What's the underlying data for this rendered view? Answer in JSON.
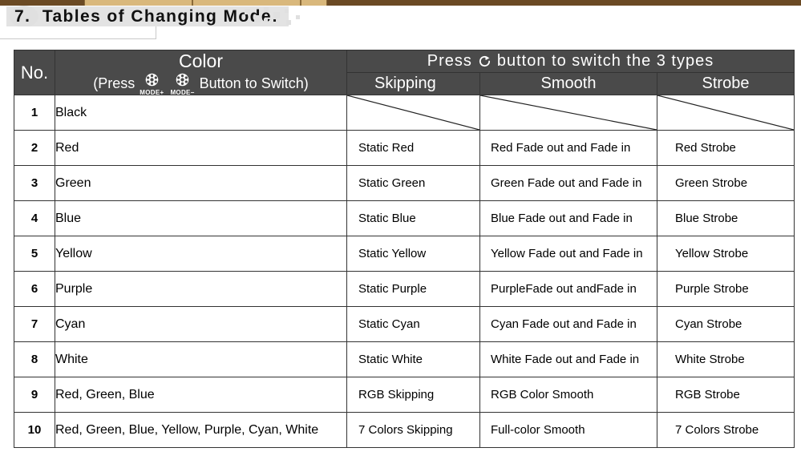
{
  "top_bar": {
    "segments": 3
  },
  "heading": {
    "number": "7.",
    "text": "Tables of Changing Mode:"
  },
  "table": {
    "header": {
      "no_label": "No.",
      "color_title": "Color",
      "color_sub_prefix": "(Press",
      "color_sub_suffix": "Button to Switch)",
      "mode_plus_icon": "film-reel-icon",
      "mode_plus_caption": "MODE+",
      "mode_minus_icon": "film-reel-icon",
      "mode_minus_caption": "MODE−",
      "press_prefix": "Press",
      "press_icon": "circular-arrow-icon",
      "press_suffix": "button  to  switch  the  3  types",
      "type_columns": [
        "Skipping",
        "Smooth",
        "Strobe"
      ]
    },
    "rows": [
      {
        "no": "1",
        "color": "Black",
        "skipping": "",
        "smooth": "",
        "strobe": "",
        "struck": true
      },
      {
        "no": "2",
        "color": "Red",
        "skipping": "Static Red",
        "smooth": "Red Fade out and Fade in",
        "strobe": "Red Strobe",
        "struck": false
      },
      {
        "no": "3",
        "color": "Green",
        "skipping": "Static Green",
        "smooth": "Green Fade out and Fade in",
        "strobe": "Green Strobe",
        "struck": false
      },
      {
        "no": "4",
        "color": "Blue",
        "skipping": "Static Blue",
        "smooth": "Blue Fade out and Fade in",
        "strobe": "Blue Strobe",
        "struck": false
      },
      {
        "no": "5",
        "color": "Yellow",
        "skipping": "Static Yellow",
        "smooth": "Yellow Fade out and Fade in",
        "strobe": "Yellow Strobe",
        "struck": false
      },
      {
        "no": "6",
        "color": "Purple",
        "skipping": "Static Purple",
        "smooth": "PurpleFade out andFade in",
        "strobe": "Purple Strobe",
        "struck": false
      },
      {
        "no": "7",
        "color": "Cyan",
        "skipping": "Static Cyan",
        "smooth": "Cyan Fade out and Fade in",
        "strobe": "Cyan Strobe",
        "struck": false
      },
      {
        "no": "8",
        "color": "White",
        "skipping": "Static White",
        "smooth": "White Fade out and Fade in",
        "strobe": "White Strobe",
        "struck": false
      },
      {
        "no": "9",
        "color": "Red, Green, Blue",
        "skipping": "RGB Skipping",
        "smooth": "RGB Color Smooth",
        "strobe": "RGB Strobe",
        "struck": false
      },
      {
        "no": "10",
        "color": "Red, Green, Blue, Yellow, Purple, Cyan, White",
        "skipping": "7 Colors Skipping",
        "smooth": "Full-color Smooth",
        "strobe": "7 Colors Strobe",
        "struck": false
      }
    ]
  },
  "colors": {
    "header_bg": "#4a4a4a",
    "header_text": "#ffffff",
    "border": "#333333",
    "bar_light": "#d9b87c",
    "bar_dark": "#6b4a24",
    "banner_gray": "#e3e3e3"
  }
}
